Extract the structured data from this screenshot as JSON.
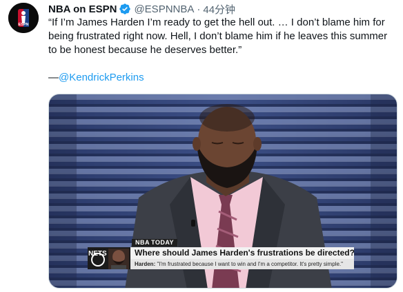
{
  "author": {
    "display_name": "NBA on ESPN",
    "handle": "@ESPNNBA",
    "separator": "·",
    "timestamp": "44分钟",
    "verified": true,
    "avatar_text": "ESPN"
  },
  "tweet": {
    "line1": "“If I’m James Harden I’m ready to get the hell out. … I don’t blame him for",
    "line2": "being frustrated right now. Hell, I don’t blame him if he leaves this summer",
    "line3": "to be honest because he deserves better.”",
    "signature_dash": "—",
    "signature_mention": "@KendrickPerkins"
  },
  "media": {
    "brand_nba": "NBA",
    "brand_today": "TODAY",
    "team_logo_text": "NETS",
    "headline": "Where should James Harden's frustrations be directed?",
    "quote_speaker": "Harden:",
    "quote_text": "\"I'm frustrated because I want to win and I'm a competitor. It's pretty simple.\""
  },
  "colors": {
    "link": "#1d9bf0",
    "verified_badge": "#1d9bf0",
    "secondary_text": "#536471"
  }
}
